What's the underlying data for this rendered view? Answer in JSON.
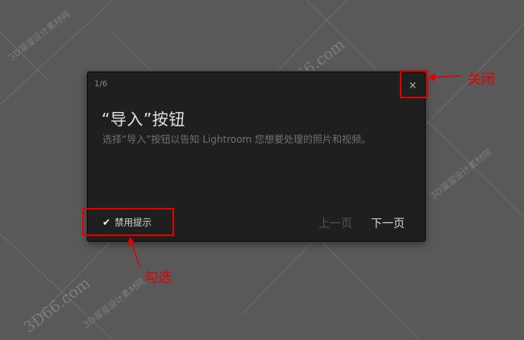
{
  "watermark": {
    "site_text": "3D66.com",
    "cn_text": "3D溜溜设计素材网"
  },
  "tip": {
    "counter": "1/6",
    "close_symbol": "×",
    "title": "“导入”按钮",
    "description": "选择“导入”按钮以告知 Lightroom 您想要处理的照片和视频。",
    "disable_checked": true,
    "disable_label": "禁用提示",
    "prev_label": "上一页",
    "next_label": "下一页"
  },
  "annotations": {
    "close_label": "关闭",
    "check_label": "勾选",
    "color": "#e00000"
  },
  "colors": {
    "background": "#595959",
    "panel": "#1f1f1f",
    "annotation": "#e00000"
  }
}
